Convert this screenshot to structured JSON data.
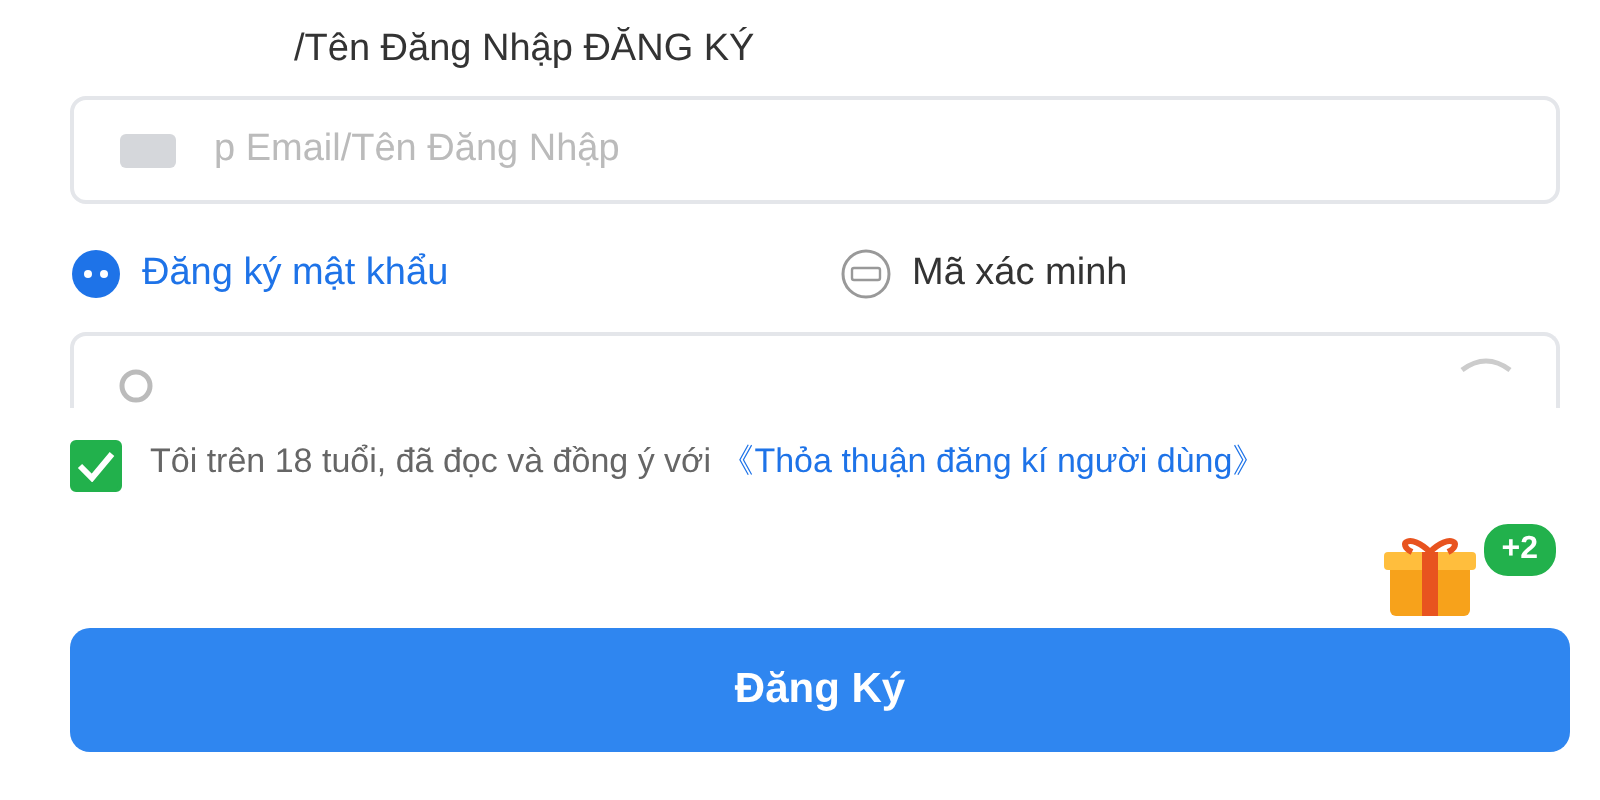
{
  "account_label": "/Tên Đăng Nhập ĐĂNG KÝ",
  "account_field": {
    "placeholder": "p Email/Tên Đăng Nhập"
  },
  "modes": [
    {
      "label": "Đăng ký mật khẩu",
      "kind": "password",
      "selected": true
    },
    {
      "label": "Mã xác minh",
      "kind": "code",
      "selected": false
    }
  ],
  "agreement": {
    "checked": true,
    "text": "Tôi trên 18 tuổi, đã đọc và đồng ý với",
    "link": "《Thỏa thuận đăng kí người dùng》"
  },
  "gift": {
    "badge": "+2"
  },
  "submit_button": "Đăng Ký"
}
